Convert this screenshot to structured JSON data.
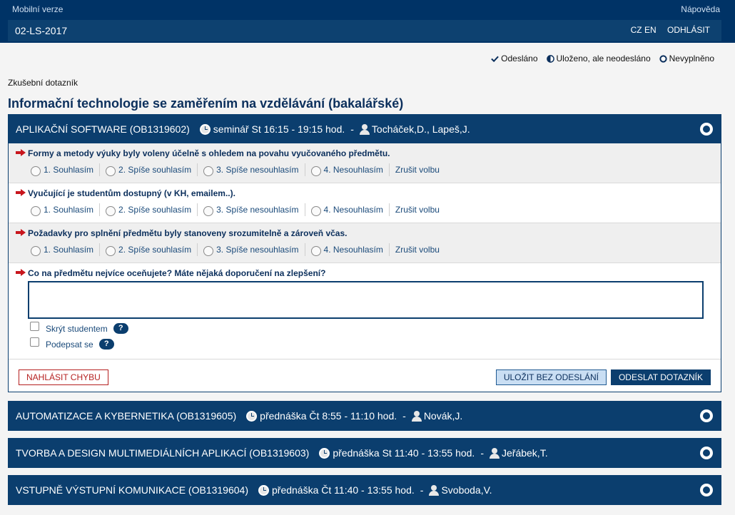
{
  "header": {
    "mobile_label": "Mobilní verze",
    "help_label": "Nápověda",
    "code": "02-LS-2017",
    "lang": "CZ EN",
    "logout": "ODHLÁSIT"
  },
  "legend": {
    "sent": "Odesláno",
    "saved": "Uloženo, ale neodesláno",
    "empty": "Nevyplněno"
  },
  "page": {
    "subtitle": "Zkušební dotazník",
    "title": "Informační technologie se zaměřením na vzdělávání (bakalářské)"
  },
  "courses": [
    {
      "name": "APLIKAČNÍ SOFTWARE (OB1319602)",
      "time": "seminář St 16:15 - 19:15 hod.",
      "sep": "-",
      "teachers": "Tocháček,D., Lapeš,J."
    },
    {
      "name": "AUTOMATIZACE A KYBERNETIKA (OB1319605)",
      "time": "přednáška Čt 8:55 - 11:10 hod.",
      "sep": "-",
      "teachers": "Novák,J."
    },
    {
      "name": "TVORBA A DESIGN MULTIMEDIÁLNÍCH APLIKACÍ (OB1319603)",
      "time": "přednáška St 11:40 - 13:55 hod.",
      "sep": "-",
      "teachers": "Jeřábek,T."
    },
    {
      "name": "VSTUPNĚ VÝSTUPNÍ KOMUNIKACE (OB1319604)",
      "time": "přednáška Čt 11:40 - 13:55 hod.",
      "sep": "-",
      "teachers": "Svoboda,V."
    }
  ],
  "questions": [
    "Formy a metody výuky byly voleny účelně s ohledem na povahu vyučovaného předmětu.",
    "Vyučující je studentům dostupný (v KH, emailem..).",
    "Požadavky pro splnění předmětu byly stanoveny srozumitelně a zároveň včas."
  ],
  "options": [
    "1. Souhlasím",
    "2. Spíše souhlasím",
    "3. Spíše nesouhlasím",
    "4. Nesouhlasím"
  ],
  "cancel_label": "Zrušit volbu",
  "open_question": "Co na předmětu nejvíce oceňujete? Máte nějaká doporučení na zlepšení?",
  "hide_label": "Skrýt studentem",
  "sign_label": "Podepsat se",
  "help_mark": "?",
  "buttons": {
    "report": "NAHLÁSIT CHYBU",
    "save": "ULOŽIT BEZ ODESLÁNÍ",
    "send": "ODESLAT DOTAZNÍK"
  },
  "colors": {
    "primary": "#0b3e6e",
    "arrow": "#c8161d"
  }
}
